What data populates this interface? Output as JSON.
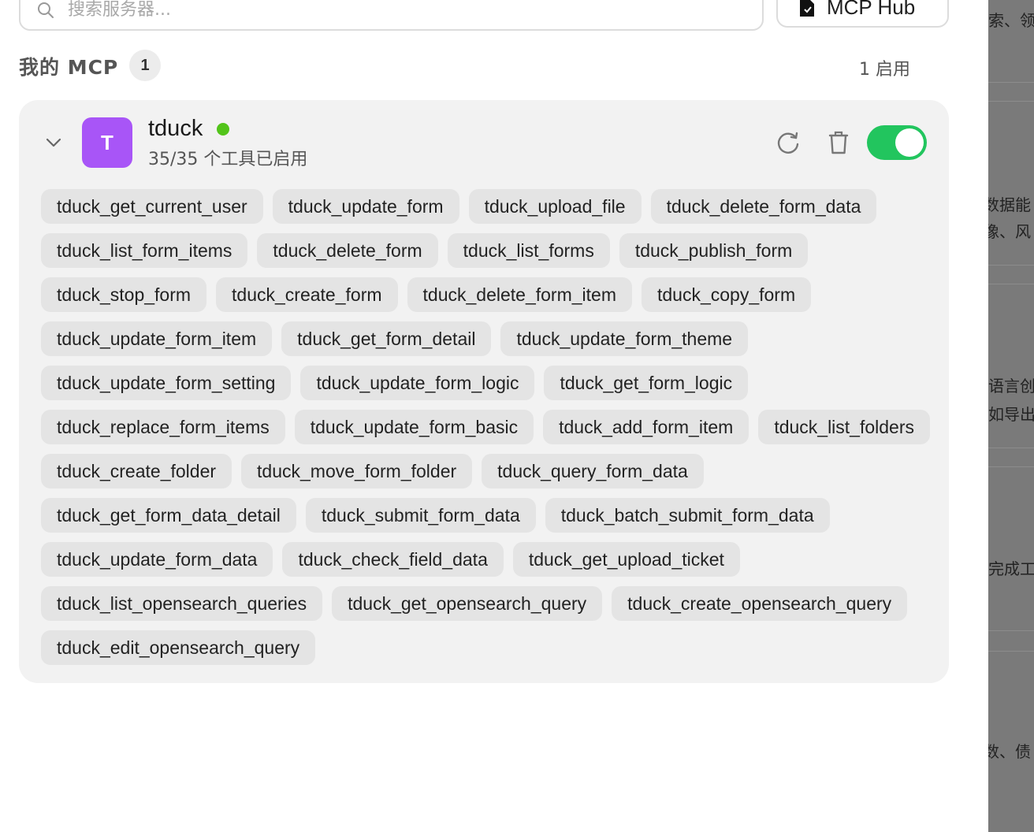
{
  "search": {
    "placeholder": "搜索服务器..."
  },
  "hub_button": {
    "label": "MCP Hub"
  },
  "section": {
    "title": "我的 MCP",
    "count": "1",
    "enabled_label": "1 启用"
  },
  "server": {
    "avatar_letter": "T",
    "name": "tduck",
    "status_color": "#52c41a",
    "tools_summary": "35/35 个工具已启用",
    "enabled": true,
    "tools": [
      "tduck_get_current_user",
      "tduck_update_form",
      "tduck_upload_file",
      "tduck_delete_form_data",
      "tduck_list_form_items",
      "tduck_delete_form",
      "tduck_list_forms",
      "tduck_publish_form",
      "tduck_stop_form",
      "tduck_create_form",
      "tduck_delete_form_item",
      "tduck_copy_form",
      "tduck_update_form_item",
      "tduck_get_form_detail",
      "tduck_update_form_theme",
      "tduck_update_form_setting",
      "tduck_update_form_logic",
      "tduck_get_form_logic",
      "tduck_replace_form_items",
      "tduck_update_form_basic",
      "tduck_add_form_item",
      "tduck_list_folders",
      "tduck_create_folder",
      "tduck_move_form_folder",
      "tduck_query_form_data",
      "tduck_get_form_data_detail",
      "tduck_submit_form_data",
      "tduck_batch_submit_form_data",
      "tduck_update_form_data",
      "tduck_check_field_data",
      "tduck_get_upload_ticket",
      "tduck_list_opensearch_queries",
      "tduck_get_opensearch_query",
      "tduck_create_opensearch_query",
      "tduck_edit_opensearch_query"
    ]
  },
  "background_fragments": [
    "索、领",
    "数据能",
    "像、风",
    "语言创",
    "如导出",
    "完成工",
    "数、债"
  ],
  "colors": {
    "accent_green": "#22c55e",
    "avatar_purple": "#a855f7"
  }
}
